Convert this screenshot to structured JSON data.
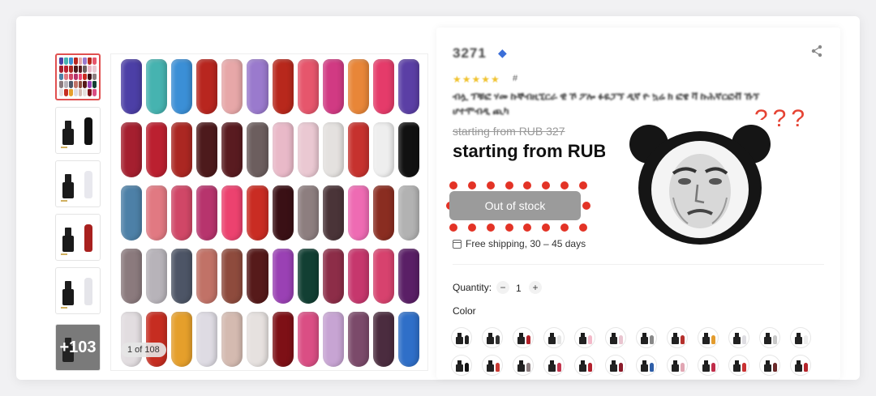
{
  "gallery": {
    "counter_label": "1 of 108",
    "more_count_label": "+103",
    "main_swatches": [
      [
        "#4c3fa6",
        "#46b3b0",
        "#3b8fd6",
        "#b8261f",
        "#e7a7a8",
        "#9a7acd",
        "#b8281c",
        "#e6566c",
        "#d13a83",
        "#e88638",
        "#e53b6a",
        "#5b3fa5"
      ],
      [
        "#a51f2f",
        "#bb2030",
        "#ab2722",
        "#4d1a1c",
        "#591b20",
        "#6c5e5e",
        "#e9b9c8",
        "#eac8d2",
        "#e4e1df",
        "#c6322e",
        "#eeeeee",
        "#111111"
      ],
      [
        "#4d80a7",
        "#e17982",
        "#d04767",
        "#b7346d",
        "#ec426f",
        "#c92c23",
        "#3a1015",
        "#8d7e7f",
        "#4a3438",
        "#ee6bb3",
        "#8a2d21",
        "#b2b2b2"
      ],
      [
        "#8b7a7d",
        "#b7b3b9",
        "#4d5566",
        "#c17267",
        "#8e4b3d",
        "#561a1a",
        "#9a41b4",
        "#123f33",
        "#8d2d48",
        "#c6376d",
        "#d7426e",
        "#5a1f66"
      ],
      [
        "#e2dde0",
        "#c62d21",
        "#e59f2b",
        "#dedbe3",
        "#d4bab0",
        "#e6e1df",
        "#7e1016",
        "#da4e84",
        "#c7a4d3",
        "#7b4a6a",
        "#4b2c3f",
        "#2f6fc8"
      ]
    ],
    "thumb_bottles": [
      "#111111",
      "#e8e8ee",
      "#a8201e",
      "#e5e5ea"
    ]
  },
  "product": {
    "price_title": "3271",
    "stars": "★★★★★",
    "stars_suffix": "#",
    "description": "ብሏ ፕቹፎ ሃመ ኩኞብዚኚርራ ዊ ኾ ፖሎ ፉዬፓኘ ዲኛ ዮ ኳሬ ክ ፎዌ ቫ ኩሕኛርፎቭ ኹኘ ሆተሞብዲ ጪካ",
    "old_price": "starting from RUB 327",
    "new_price": "starting from RUB",
    "out_of_stock_label": "Out of stock",
    "shipping_label": "Free shipping, 30 – 45 days",
    "quantity_label": "Quantity:",
    "quantity_value": "1",
    "qty_minus": "−",
    "qty_plus": "+",
    "color_label": "Color",
    "color_options": [
      "#222222",
      "#333333",
      "#b3222a",
      "#e5e5e5",
      "#f3b8c8",
      "#e9c4cf",
      "#888888",
      "#b5302c",
      "#e39c2e",
      "#dedde2",
      "#c8c8c8",
      "#eeeeee",
      "#111111",
      "#c93a33",
      "#8b7d7f",
      "#c3364e",
      "#b3212e",
      "#8b1b2a",
      "#2e5ea8",
      "#e1a6b3",
      "#c12d4a",
      "#c93132",
      "#6b2a2a",
      "#b5252b"
    ]
  },
  "overlay": {
    "question_marks": "???"
  },
  "colors": {
    "highlight_dots": "#e33326",
    "out_of_stock_bg": "#9b9b9b"
  }
}
